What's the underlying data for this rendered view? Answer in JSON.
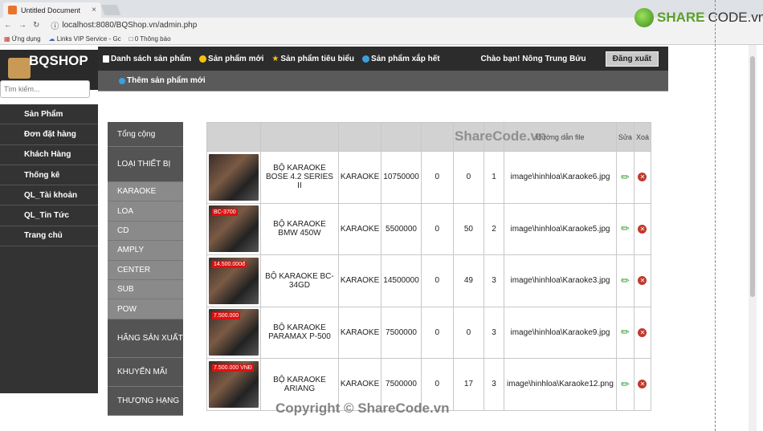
{
  "browser": {
    "tab_title": "Untitled Document",
    "tab_close": "×",
    "url": "localhost:8080/BQShop.vn/admin.php",
    "bookmarks": [
      "Ứng dụng",
      "Links VIP Service - Gc",
      "0 Thông báo"
    ]
  },
  "logo": {
    "share": "SHARE",
    "code": "CODE.vn"
  },
  "brand": {
    "name": "BQSHOP"
  },
  "search": {
    "placeholder": "Tìm kiếm..."
  },
  "topnav": {
    "items": [
      "Danh sách sản phẩm",
      "Sản phẩm mới",
      "Sản phẩm tiêu biểu",
      "Sản phẩm xắp hết"
    ],
    "greeting": "Chào bạn! Nông Trung Bứu",
    "logout": "Đăng xuất"
  },
  "subnav": {
    "add_product": "Thêm sản phẩm mới"
  },
  "sidebar": {
    "items": [
      "Sản Phẩm",
      "Đơn đặt hàng",
      "Khách Hàng",
      "Thống kê",
      "QL_Tài khoản",
      "QL_Tin Tức",
      "Trang chủ"
    ]
  },
  "categories": {
    "total": "Tổng cộng",
    "device_type": "LOẠI THIẾT BỊ",
    "subs": [
      "KARAOKE",
      "LOA",
      "CD",
      "AMPLY",
      "CENTER",
      "SUB",
      "POW"
    ],
    "manufacturer": "HÃNG SẢN XUẤT",
    "promo": "KHUYẾN MÃI",
    "brand": "THƯỢNG HẠNG"
  },
  "table": {
    "headers": [
      "",
      "",
      "",
      "",
      "",
      "",
      "",
      "Đường dẫn file",
      "Sửa",
      "Xoá"
    ],
    "rows": [
      {
        "name": "BỘ KARAOKE BOSE 4.2 SERIES II",
        "type": "KARAOKE",
        "price": "10750000",
        "c1": "0",
        "c2": "0",
        "c3": "1",
        "file": "image\\hinhloa\\Karaoke6.jpg",
        "badge": ""
      },
      {
        "name": "BỘ KARAOKE BMW 450W",
        "type": "KARAOKE",
        "price": "5500000",
        "c1": "0",
        "c2": "50",
        "c3": "2",
        "file": "image\\hinhloa\\Karaoke5.jpg",
        "badge": "BC-3700"
      },
      {
        "name": "BỘ KARAOKE BC-34GD",
        "type": "KARAOKE",
        "price": "14500000",
        "c1": "0",
        "c2": "49",
        "c3": "3",
        "file": "image\\hinhloa\\Karaoke3.jpg",
        "badge": "14.500.000đ"
      },
      {
        "name": "BỘ KARAOKE PARAMAX P-500",
        "type": "KARAOKE",
        "price": "7500000",
        "c1": "0",
        "c2": "0",
        "c3": "3",
        "file": "image\\hinhloa\\Karaoke9.jpg",
        "badge": "7.500.000"
      },
      {
        "name": "BỘ KARAOKE ARIANG",
        "type": "KARAOKE",
        "price": "7500000",
        "c1": "0",
        "c2": "17",
        "c3": "3",
        "file": "image\\hinhloa\\Karaoke12.png",
        "badge": "7.500.000 VNĐ"
      }
    ]
  },
  "watermark": "ShareCode.vn",
  "copyright": "Copyright © ShareCode.vn",
  "colors": {
    "topbar": "#2c2c2c",
    "sidebar": "#333333",
    "accent_green": "#5aa02c",
    "delete_red": "#c0392b"
  }
}
